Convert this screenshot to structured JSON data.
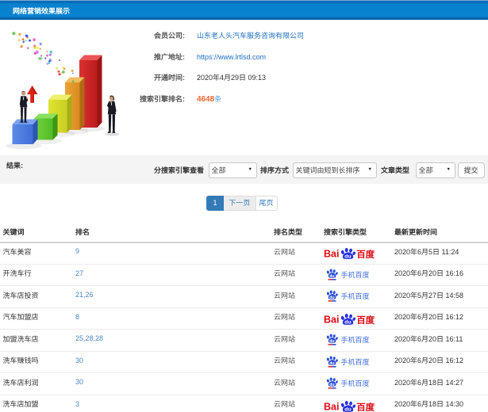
{
  "header": {
    "title": "网络营销效果展示"
  },
  "info": {
    "fields": [
      {
        "label": "会员公司:",
        "value": "山东老人头汽车服务咨询有限公司"
      },
      {
        "label": "推广地址:",
        "value": "https://www.lrtlsd.com"
      },
      {
        "label": "开通时间:",
        "value": "2020年4月29日 09:13"
      },
      {
        "label": "搜索引擎排名:",
        "value": "4648",
        "suffix": "条"
      }
    ]
  },
  "filter": {
    "result_label": "结果:",
    "engine_label": "分搜索引擎查看",
    "engine_value": "全部",
    "sort_label": "排序方式",
    "sort_value": "关键词由短到长排序",
    "type_label": "文章类型",
    "type_value": "全部",
    "submit_label": "提交",
    "dropdown_arrow": "▼"
  },
  "pagination": {
    "current": "1",
    "next_label": "下一页",
    "last_label": "尾页"
  },
  "table": {
    "columns": [
      "关键词",
      "排名",
      "排名类型",
      "搜索引擎类型",
      "最新更新时间"
    ],
    "rows": [
      {
        "keyword": "汽车美容",
        "rank": "9",
        "rank_type": "云网站",
        "engine": "baidu",
        "updated": "2020年6月5日 11:24"
      },
      {
        "keyword": "开洗车行",
        "rank": "27",
        "rank_type": "云网站",
        "engine": "mobile-baidu",
        "updated": "2020年6月20日 16:16"
      },
      {
        "keyword": "洗车店投资",
        "rank": "21,26",
        "rank_type": "云网站",
        "engine": "mobile-baidu",
        "updated": "2020年5月27日 14:58"
      },
      {
        "keyword": "汽车加盟店",
        "rank": "8",
        "rank_type": "云网站",
        "engine": "baidu",
        "updated": "2020年6月20日 16:12"
      },
      {
        "keyword": "加盟洗车店",
        "rank": "25,28,28",
        "rank_type": "云网站",
        "engine": "mobile-baidu",
        "updated": "2020年6月20日 16:11"
      },
      {
        "keyword": "洗车赚钱吗",
        "rank": "30",
        "rank_type": "云网站",
        "engine": "mobile-baidu",
        "updated": "2020年6月20日 16:12"
      },
      {
        "keyword": "洗车店利润",
        "rank": "30",
        "rank_type": "云网站",
        "engine": "mobile-baidu",
        "updated": "2020年6月18日 14:27"
      },
      {
        "keyword": "洗车店加盟",
        "rank": "3",
        "rank_type": "云网站",
        "engine": "baidu",
        "updated": "2020年6月18日 14:30"
      }
    ],
    "engine_logos": {
      "baidu": {
        "latin": "Bai",
        "du": "du",
        "cjk": "百度"
      },
      "mobile_baidu": {
        "du": "du",
        "label": "手机百度"
      }
    }
  },
  "colors": {
    "titlebar_blue": "#0783d1",
    "link_blue": "#1d6fc3",
    "count_orange": "#f4682f",
    "count_suffix_blue": "#54a6dd",
    "pagination_active": "#337ab7",
    "rank_blue": "#4a87c7",
    "baidu_red": "#de0b14",
    "baidu_blue": "#2932e1",
    "mobile_baidu_blue": "#3c6ddb",
    "filter_bg": "#f4f4f4"
  }
}
